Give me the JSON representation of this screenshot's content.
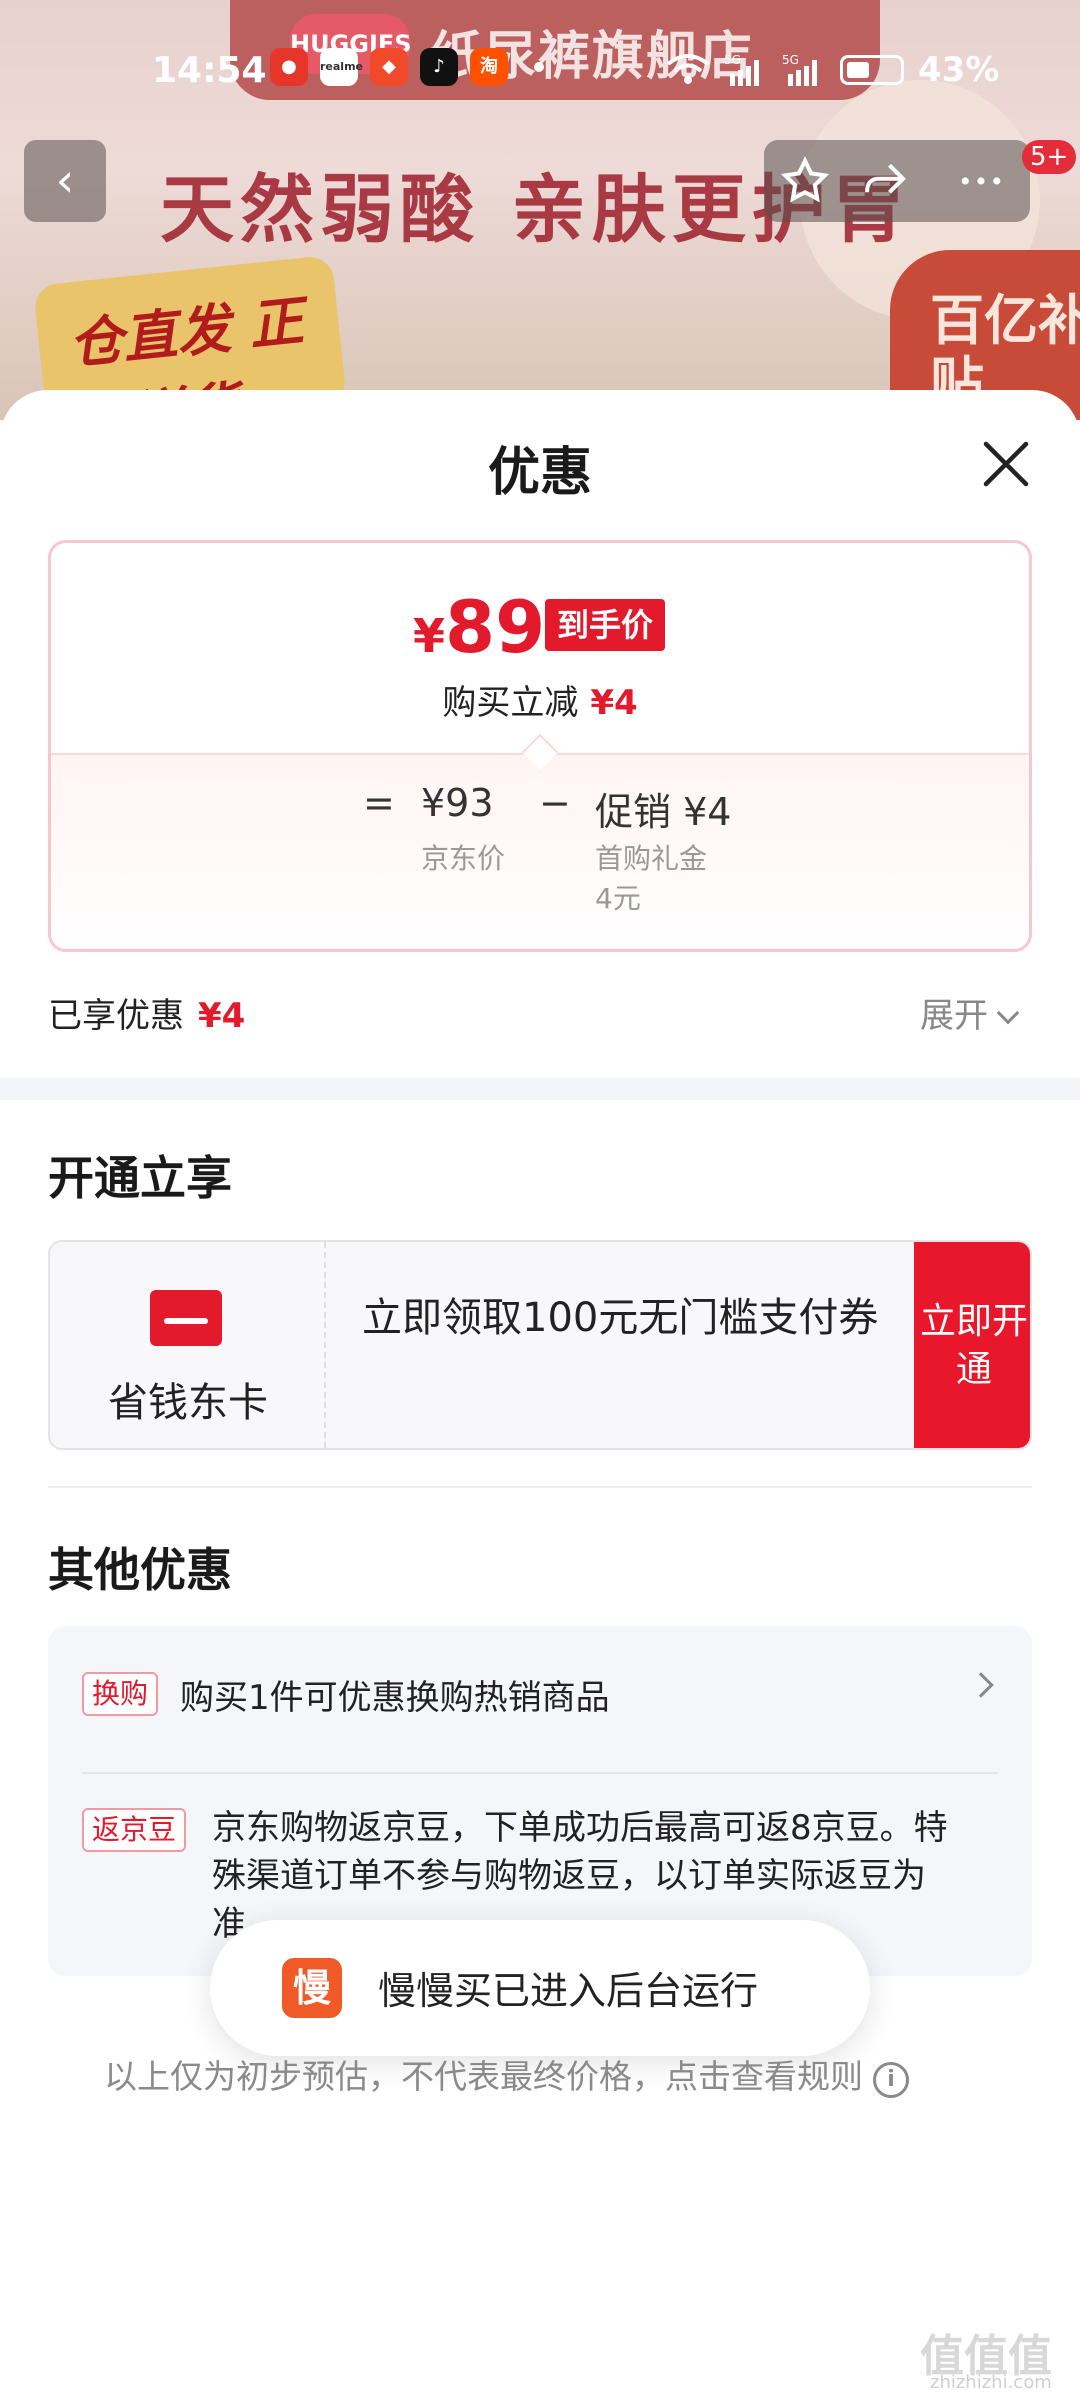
{
  "status_bar": {
    "time": "14:54",
    "battery": "43%",
    "apps": [
      "miui-icon",
      "realme",
      "fruit-icon",
      "tiktok",
      "淘"
    ]
  },
  "background": {
    "brand": "HUGGIES",
    "shop_name": "纸尿裤旗舰店",
    "slogan": "天然弱酸 亲肤更护胃",
    "badge_left": "仓直发 正品送货",
    "badge_right": "百亿补贴",
    "notification_count": "5+"
  },
  "sheet": {
    "title": "优惠",
    "price": {
      "currency": "¥",
      "amount": "89",
      "tag": "到手价",
      "reduce_label": "购买立减",
      "reduce_value": "¥4"
    },
    "calc": {
      "equals": "=",
      "jd_price": "¥93",
      "jd_price_label": "京东价",
      "minus": "−",
      "promo": "促销 ¥4",
      "promo_detail_1": "首购礼金",
      "promo_detail_2": "4元"
    },
    "enjoyed_label": "已享优惠",
    "enjoyed_value": "¥4",
    "expand_label": "展开"
  },
  "open_section": {
    "title": "开通立享",
    "card_name": "省钱东卡",
    "card_text": "立即领取100元无门槛支付券",
    "button": "立即开通"
  },
  "other_section": {
    "title": "其他优惠",
    "items": [
      {
        "tag": "换购",
        "text": "购买1件可优惠换购热销商品"
      },
      {
        "tag": "返京豆",
        "text": "京东购物返京豆，下单成功后最高可返8京豆。特殊渠道订单不参与购物返豆，以订单实际返豆为准。"
      }
    ]
  },
  "toast": {
    "icon_char": "慢",
    "text": "慢慢买已进入后台运行"
  },
  "disclaimer": "以上仅为初步预估，不代表最终价格，点击查看规则",
  "watermark": "值值值",
  "watermark_url": "zhizhizhi.com"
}
